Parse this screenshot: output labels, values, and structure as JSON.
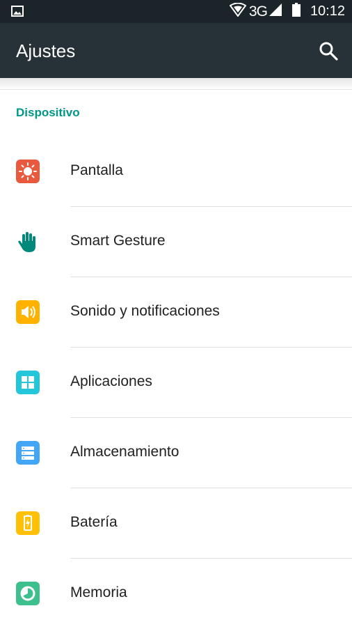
{
  "status_bar": {
    "network": "3G",
    "time": "10:12"
  },
  "app_bar": {
    "title": "Ajustes"
  },
  "section": {
    "header": "Dispositivo"
  },
  "items": [
    {
      "label": "Pantalla",
      "icon": "brightness-icon",
      "color": "#e8593d"
    },
    {
      "label": "Smart Gesture",
      "icon": "hand-gesture-icon",
      "color": "#00897b"
    },
    {
      "label": "Sonido y notificaciones",
      "icon": "speaker-icon",
      "color": "#ffb300"
    },
    {
      "label": "Aplicaciones",
      "icon": "apps-grid-icon",
      "color": "#26c6da"
    },
    {
      "label": "Almacenamiento",
      "icon": "storage-icon",
      "color": "#42a5f5"
    },
    {
      "label": "Batería",
      "icon": "battery-icon",
      "color": "#ffc107"
    },
    {
      "label": "Memoria",
      "icon": "memory-icon",
      "color": "#3dbf8e"
    }
  ]
}
